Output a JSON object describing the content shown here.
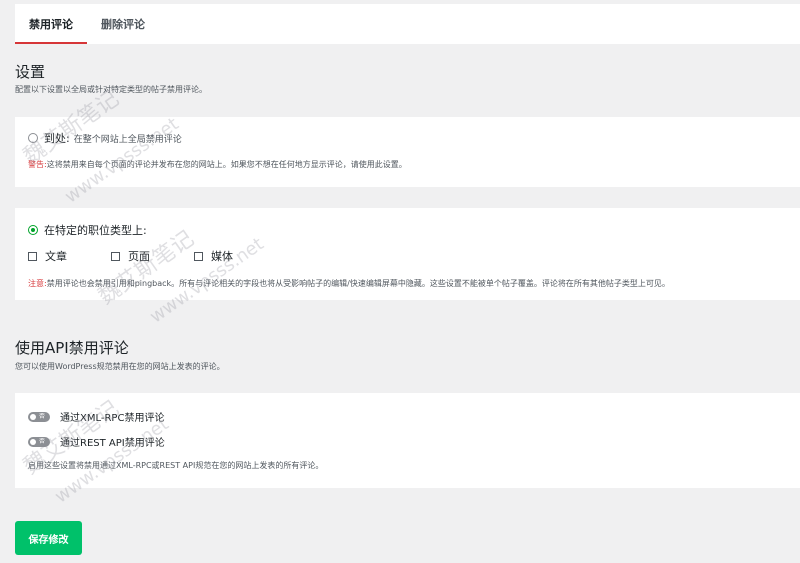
{
  "tabs": [
    {
      "label": "禁用评论",
      "active": true
    },
    {
      "label": "删除评论",
      "active": false
    }
  ],
  "settings": {
    "title": "设置",
    "description": "配置以下设置以全局或针对特定类型的帖子禁用评论。",
    "everywhere": {
      "label": "到处:",
      "hint": "在整个网站上全局禁用评论",
      "warning_label": "警告:",
      "warning_text": "这将禁用来自每个页面的评论并发布在您的网站上。如果您不想在任何地方显示评论，请使用此设置。",
      "checked": false
    },
    "specific": {
      "label": "在特定的职位类型上:",
      "checked": true,
      "types": [
        {
          "label": "文章",
          "checked": false
        },
        {
          "label": "页面",
          "checked": false
        },
        {
          "label": "媒体",
          "checked": false
        }
      ],
      "note_label": "注意:",
      "note_text": "禁用评论也会禁用引用和pingback。所有与评论相关的字段也将从受影响帖子的编辑/快速编辑屏幕中隐藏。这些设置不能被单个帖子覆盖。评论将在所有其他帖子类型上可见。"
    }
  },
  "api": {
    "title": "使用API禁用评论",
    "description": "您可以使用WordPress规范禁用在您的网站上发表的评论。",
    "toggles": [
      {
        "label": "通过XML-RPC禁用评论",
        "state_text": "否",
        "on": false
      },
      {
        "label": "通过REST API禁用评论",
        "state_text": "否",
        "on": false
      }
    ],
    "footer_note": "启用这些设置将禁用通过XML-RPC或REST API规范在您的网站上发表的所有评论。"
  },
  "save_button": "保存修改",
  "watermark": [
    "魏艾斯笔记",
    "www.vpsss.net"
  ],
  "colors": {
    "accent_red": "#d63638",
    "accent_green": "#00c16a",
    "radio_green": "#00a32a"
  }
}
